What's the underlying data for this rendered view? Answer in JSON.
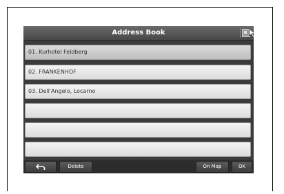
{
  "header": {
    "title": "Address Book"
  },
  "entries": [
    {
      "label": "01.  Kurhotel Feldberg"
    },
    {
      "label": "02.  FRANKENHOF"
    },
    {
      "label": "03.  Dell'Angelo, Locarno"
    },
    {
      "label": ""
    },
    {
      "label": ""
    },
    {
      "label": ""
    }
  ],
  "toolbar": {
    "delete_label": "Delete",
    "onmap_label": "On Map",
    "ok_label": "OK"
  },
  "icons": {
    "back": "back-arrow-icon",
    "scroll_up": "triangle-up-icon",
    "scroll_down": "triangle-down-icon",
    "view": "map-view-icon",
    "cursor": "pointer-icon"
  }
}
